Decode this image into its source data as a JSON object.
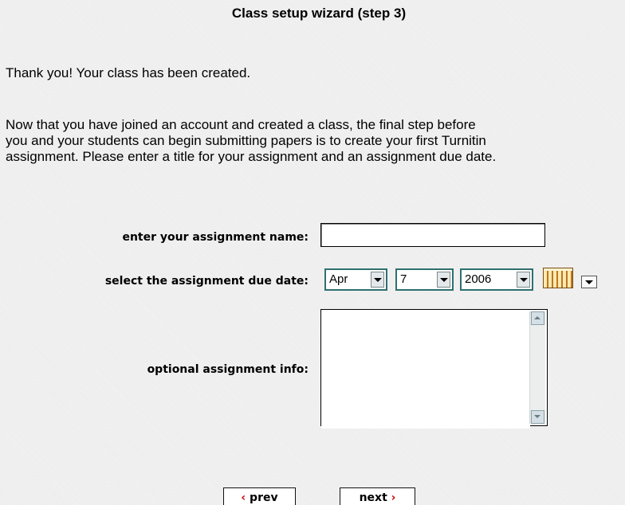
{
  "header": {
    "title": "Class setup wizard (step 3)"
  },
  "intro": {
    "thanks": "Thank you! Your class has been created.",
    "lines": [
      "Now that you have joined an account and created a class, the final step before",
      "you and your students can begin submitting papers is to create your first Turnitin",
      "assignment. Please enter a title for your assignment and an assignment due date."
    ]
  },
  "form": {
    "name_label": "enter your assignment name:",
    "name_value": "",
    "date_label": "select the assignment due date:",
    "month": "Apr",
    "day": "7",
    "year": "2006",
    "info_label": "optional assignment info:",
    "info_value": ""
  },
  "nav": {
    "prev_chevron": "‹",
    "prev_label": "prev",
    "next_label": "next",
    "next_chevron": "›"
  },
  "colors": {
    "accent_chevron": "#cc0000",
    "select_border": "#2f6f6f",
    "calendar": "#c88a2c"
  }
}
